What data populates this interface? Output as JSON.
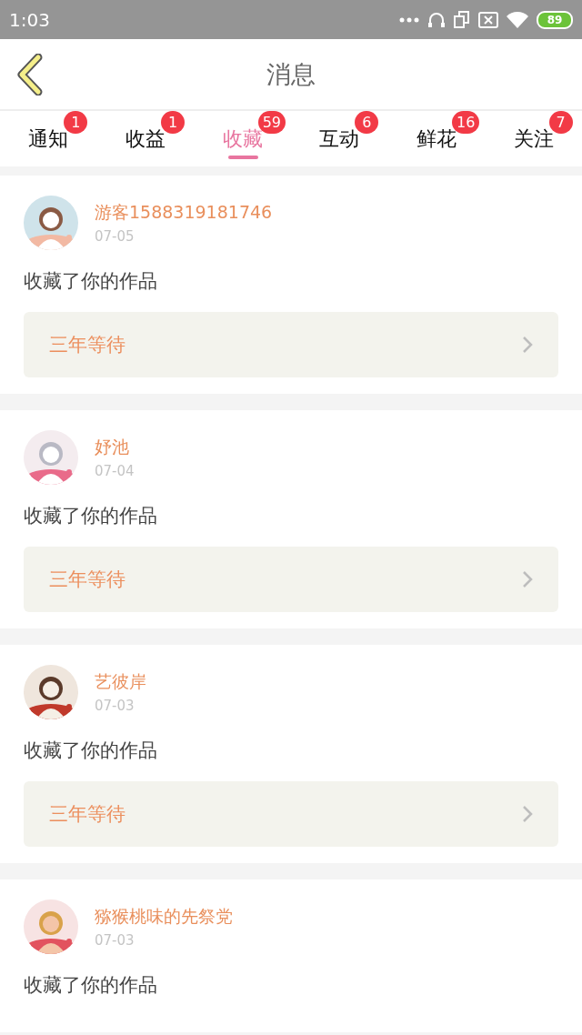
{
  "status_bar": {
    "time": "1:03",
    "battery": "89"
  },
  "header": {
    "title": "消息"
  },
  "tabs": [
    {
      "label": "通知",
      "badge": "1",
      "selected": false
    },
    {
      "label": "收益",
      "badge": "1",
      "selected": false
    },
    {
      "label": "收藏",
      "badge": "59",
      "selected": true
    },
    {
      "label": "互动",
      "badge": "6",
      "selected": false
    },
    {
      "label": "鲜花",
      "badge": "16",
      "selected": false
    },
    {
      "label": "关注",
      "badge": "7",
      "selected": false
    }
  ],
  "messages": [
    {
      "user": "游客1588319181746",
      "date": "07-05",
      "text": "收藏了你的作品",
      "work": "三年等待"
    },
    {
      "user": "妤池",
      "date": "07-04",
      "text": "收藏了你的作品",
      "work": "三年等待"
    },
    {
      "user": "艺彼岸",
      "date": "07-03",
      "text": "收藏了你的作品",
      "work": "三年等待"
    },
    {
      "user": "猕猴桃味的先祭党",
      "date": "07-03",
      "text": "收藏了你的作品"
    }
  ]
}
